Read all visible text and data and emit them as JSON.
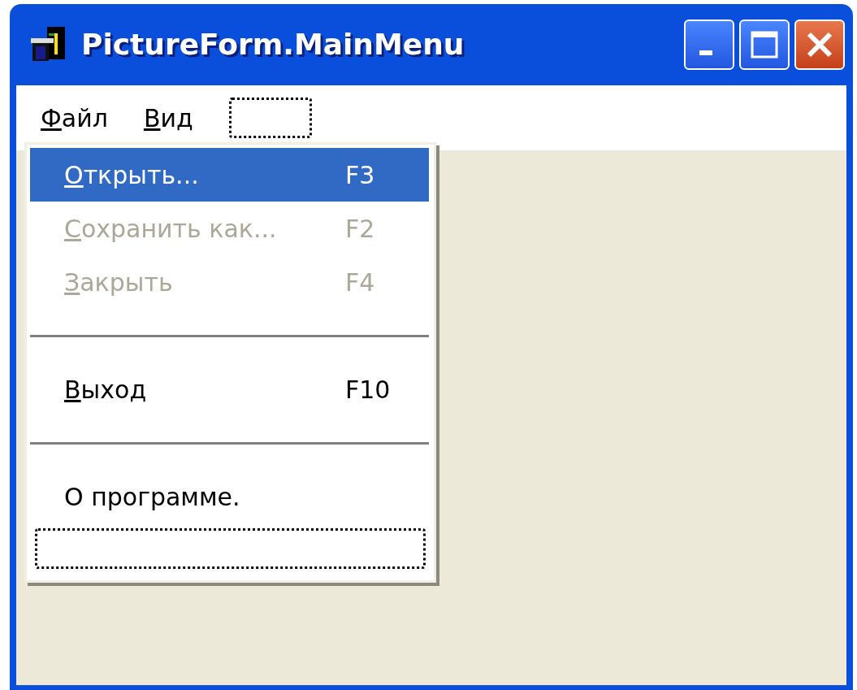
{
  "window": {
    "title": "PictureForm.MainMenu"
  },
  "menu_bar": {
    "items": [
      {
        "label": "Файл",
        "mnemonic_underlined": true
      },
      {
        "label": "Вид",
        "mnemonic_underlined": true
      }
    ],
    "has_new_item_slot": true
  },
  "dropdown": {
    "items": [
      {
        "kind": "item",
        "label": "Открыть...",
        "shortcut": "F3",
        "selected": true,
        "disabled": false,
        "mnemonic_underlined": true
      },
      {
        "kind": "item",
        "label": "Сохранить как...",
        "shortcut": "F2",
        "selected": false,
        "disabled": true,
        "mnemonic_underlined": true
      },
      {
        "kind": "item",
        "label": "Закрыть",
        "shortcut": "F4",
        "selected": false,
        "disabled": true,
        "mnemonic_underlined": true
      },
      {
        "kind": "separator"
      },
      {
        "kind": "item",
        "label": "Выход",
        "shortcut": "F10",
        "selected": false,
        "disabled": false,
        "mnemonic_underlined": true
      },
      {
        "kind": "separator"
      },
      {
        "kind": "item",
        "label": "О программе.",
        "selected": false,
        "disabled": false,
        "mnemonic_underlined": false
      },
      {
        "kind": "new_item_slot"
      }
    ]
  }
}
